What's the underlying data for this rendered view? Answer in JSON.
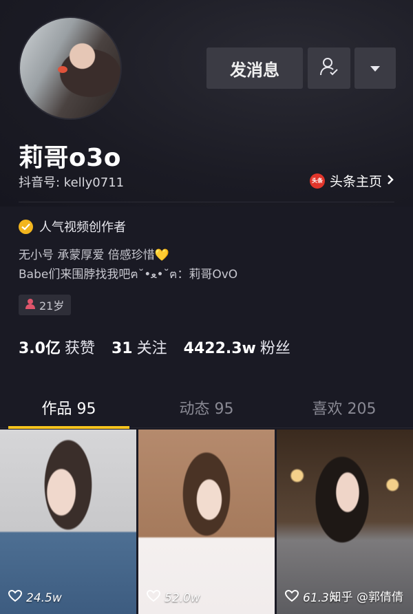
{
  "profile": {
    "username": "莉哥o3o",
    "douyin_id": "抖音号: kelly0711",
    "toutiao_logo_text": "头条",
    "toutiao_label": "头条主页",
    "verified_label": "人气视频创作者",
    "bio_line1": "无小号 承蒙厚爱 倍感珍惜💛",
    "bio_line2": "Babe们来围脖找我吧ฅ˘•ﻌ•˘ฅ：莉哥OvO",
    "age": "21岁"
  },
  "actions": {
    "message_label": "发消息",
    "follow_icon": "user-check-icon",
    "more_icon": "caret-down-icon"
  },
  "stats": {
    "likes_value": "3.0亿",
    "likes_label": "获赞",
    "following_value": "31",
    "following_label": "关注",
    "followers_value": "4422.3w",
    "followers_label": "粉丝"
  },
  "tabs": [
    {
      "label": "作品 95",
      "active": true
    },
    {
      "label": "动态 95",
      "active": false
    },
    {
      "label": "喜欢 205",
      "active": false
    }
  ],
  "videos": [
    {
      "likes": "24.5w"
    },
    {
      "likes": "52.0w"
    },
    {
      "likes": "61.3w"
    }
  ],
  "watermark": "知乎 @郭倩倩",
  "colors": {
    "background": "#1a1a24",
    "button": "#3b3b44",
    "accent_yellow": "#f7c51e",
    "verified_badge": "#f2b51e",
    "toutiao_red": "#e0352b"
  }
}
